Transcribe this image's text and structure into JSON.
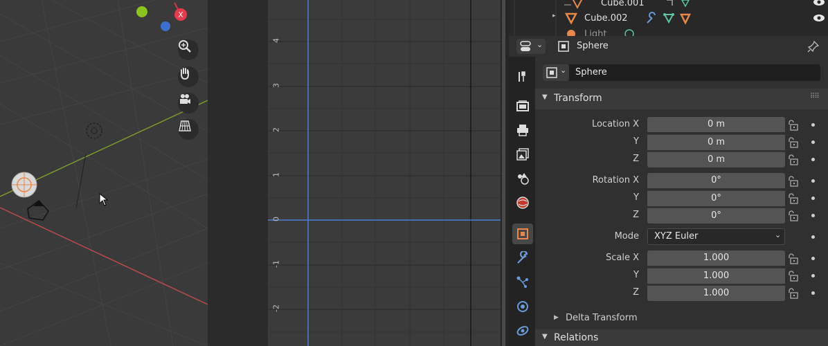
{
  "viewport": {
    "axis_gizmo": {
      "x_label": "X"
    }
  },
  "graph_editor": {
    "y_ticks": [
      "4",
      "3",
      "2",
      "1",
      "0",
      "-1",
      "-2"
    ]
  },
  "outliner": {
    "rows": [
      {
        "name": "Cube.001"
      },
      {
        "name": "Cube.002"
      },
      {
        "name": "Light"
      }
    ]
  },
  "properties": {
    "header": {
      "object_name": "Sphere"
    },
    "name_field": {
      "value": "Sphere"
    },
    "transform": {
      "title": "Transform",
      "location": {
        "label_x": "Location X",
        "label_y": "Y",
        "label_z": "Z",
        "x": "0 m",
        "y": "0 m",
        "z": "0 m"
      },
      "rotation": {
        "label_x": "Rotation X",
        "label_y": "Y",
        "label_z": "Z",
        "x": "0°",
        "y": "0°",
        "z": "0°"
      },
      "mode": {
        "label": "Mode",
        "value": "XYZ Euler"
      },
      "scale": {
        "label_x": "Scale X",
        "label_y": "Y",
        "label_z": "Z",
        "x": "1.000",
        "y": "1.000",
        "z": "1.000"
      }
    },
    "delta_transform": {
      "title": "Delta Transform"
    },
    "relations": {
      "title": "Relations"
    }
  },
  "colors": {
    "accent_blue": "#4d7fd1",
    "object_orange": "#e8884a",
    "modifier_blue": "#6b9bd8",
    "data_green": "#5fc3a5",
    "x_axis_red": "#e83a4f",
    "y_axis_green": "#8bc41c",
    "z_axis_blue": "#3d6fd1"
  }
}
